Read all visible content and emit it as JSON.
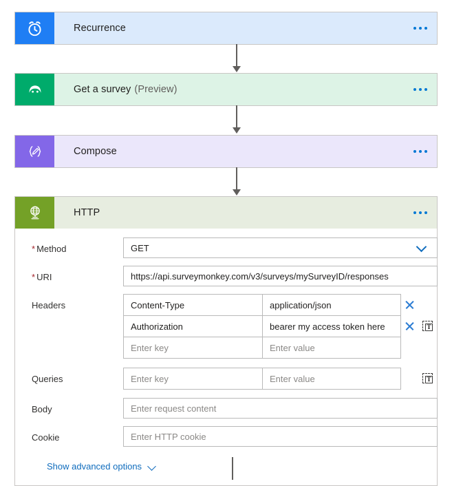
{
  "flow": {
    "steps": [
      {
        "id": "recurrence",
        "title": "Recurrence",
        "subtitle": "",
        "icon": "alarm-clock-icon",
        "menu": "more-commands"
      },
      {
        "id": "get-a-survey",
        "title": "Get a survey",
        "subtitle": "(Preview)",
        "icon": "surveymonkey-icon",
        "menu": "more-commands"
      },
      {
        "id": "compose",
        "title": "Compose",
        "subtitle": "",
        "icon": "compose-braces-pencil-icon",
        "menu": "more-commands"
      },
      {
        "id": "http",
        "title": "HTTP",
        "subtitle": "",
        "icon": "globe-network-icon",
        "menu": "more-commands"
      }
    ]
  },
  "http": {
    "method": {
      "label": "Method",
      "required": "*",
      "value": "GET",
      "chevron_icon": "chevron-down-icon"
    },
    "uri": {
      "label": "URI",
      "required": "*",
      "value": "https://api.surveymonkey.com/v3/surveys/mySurveyID/responses"
    },
    "headers": {
      "label": "Headers",
      "rows": [
        {
          "key": "Content-Type",
          "value": "application/json",
          "is_placeholder": false
        },
        {
          "key": "Authorization",
          "value": "bearer my access token here",
          "is_placeholder": false
        },
        {
          "key": "Enter key",
          "value": "Enter value",
          "is_placeholder": true
        }
      ],
      "delete_icon": "close-x-icon",
      "text_mode_icon": "switch-to-text-mode-icon",
      "text_mode_glyph": "T"
    },
    "queries": {
      "label": "Queries",
      "rows": [
        {
          "key": "Enter key",
          "value": "Enter value",
          "is_placeholder": true
        }
      ],
      "text_mode_icon": "switch-to-text-mode-icon",
      "text_mode_glyph": "T"
    },
    "body": {
      "label": "Body",
      "placeholder": "Enter request content",
      "value": ""
    },
    "cookie": {
      "label": "Cookie",
      "placeholder": "Enter HTTP cookie",
      "value": ""
    },
    "advanced": {
      "label": "Show advanced options",
      "chevron_icon": "chevron-down-icon"
    }
  },
  "colors": {
    "recurrence_icon": "#1f7ef4",
    "recurrence_body": "#dbeafc",
    "survey_icon": "#00ab6b",
    "survey_body": "#ddf3e6",
    "compose_icon": "#8367e8",
    "compose_body": "#ebe7fb",
    "http_icon": "#74a127",
    "http_body": "#e7ede0",
    "accent_blue": "#0078d4",
    "link_blue": "#0f6cbd",
    "required_red": "#a4262c",
    "connector_gray": "#605e5c"
  }
}
